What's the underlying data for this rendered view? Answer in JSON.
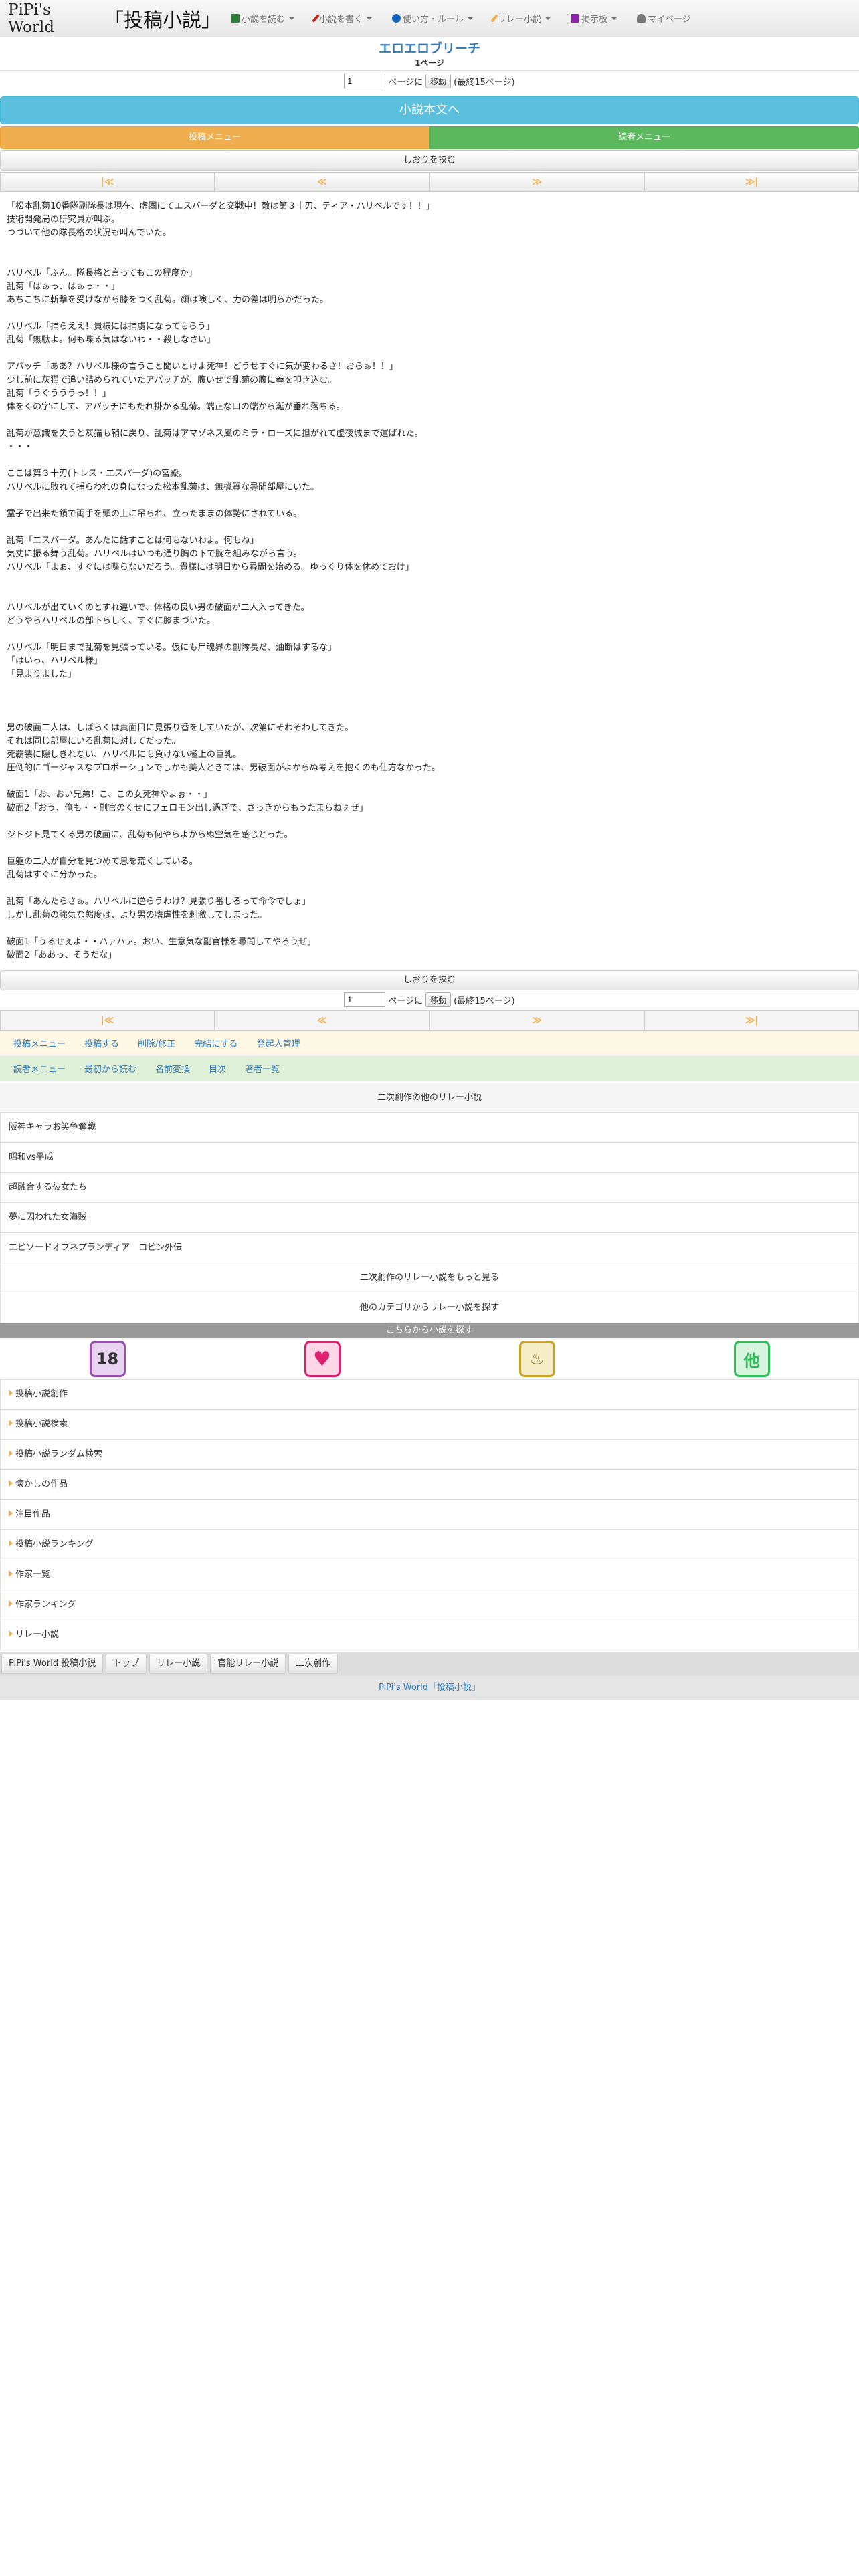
{
  "header": {
    "brand_en": "PiPi's World",
    "brand_jp": "「投稿小説」",
    "nav": [
      {
        "label": "小説を読む",
        "icon": "book-icon",
        "color": "#2e7d32"
      },
      {
        "label": "小説を書く",
        "icon": "pencil-icon",
        "color": "#c62828"
      },
      {
        "label": "使い方・ルール",
        "icon": "info-icon",
        "color": "#1565c0"
      },
      {
        "label": "リレー小説",
        "icon": "pencil-gold-icon",
        "color": "#f0ad4e"
      },
      {
        "label": "掲示板",
        "icon": "comment-icon",
        "color": "#8e24aa"
      },
      {
        "label": "マイページ",
        "icon": "user-icon",
        "color": "#777777"
      }
    ]
  },
  "title": {
    "novel_title": "エロエロブリーチ",
    "page_indicator": "1ページ"
  },
  "jump": {
    "value": "1",
    "label": "ページに",
    "button": "移動",
    "last_page": "(最終15ページ)"
  },
  "main_button": "小説本文へ",
  "menus": {
    "post_menu": "投稿メニュー",
    "reader_menu": "読者メニュー"
  },
  "bookmark": "しおりを挟む",
  "pager": {
    "first": "|≪",
    "prev": "≪",
    "next": "≫",
    "last": "≫|"
  },
  "story": [
    "「松本乱菊10番隊副隊長は現在、虚圏にてエスパーダと交戦中！敵は第３十刃、ティア・ハリベルです！！」",
    "技術開発局の研究員が叫ぶ。",
    "つづいて他の隊長格の状況も叫んでいた。",
    "",
    "",
    "ハリベル「ふん。隊長格と言ってもこの程度か」",
    "乱菊「はぁっ、はぁっ・・」",
    "あちこちに斬撃を受けながら膝をつく乱菊。顔は険しく、力の差は明らかだった。",
    "",
    "ハリベル「捕らええ！貴様には捕虜になってもらう」",
    "乱菊「無駄よ。何も喋る気はないわ・・殺しなさい」",
    "",
    "アパッチ「ああ？ハリベル様の言うこと聞いとけよ死神！どうせすぐに気が変わるさ！おらぁ！！」",
    "少し前に灰猫で追い詰められていたアパッチが、腹いせで乱菊の腹に拳を叩き込む。",
    "乱菊「うぐうううっ！！」",
    "体をくの字にして、アパッチにもたれ掛かる乱菊。端正な口の端から涎が垂れ落ちる。",
    "",
    "乱菊が意識を失うと灰猫も鞘に戻り、乱菊はアマゾネス風のミラ・ローズに担がれて虚夜城まで運ばれた。",
    "・・・",
    "",
    "ここは第３十刃(トレス・エスパーダ)の宮殿。",
    "ハリベルに敗れて捕らわれの身になった松本乱菊は、無機質な尋問部屋にいた。",
    "",
    "霊子で出来た鎖で両手を頭の上に吊られ、立ったままの体勢にされている。",
    "",
    "乱菊「エスパーダ。あんたに話すことは何もないわよ。何もね」",
    "気丈に振る舞う乱菊。ハリベルはいつも通り胸の下で腕を組みながら言う。",
    "ハリベル「まぁ、すぐには喋らないだろう。貴様には明日から尋問を始める。ゆっくり体を休めておけ」",
    "",
    "",
    "ハリベルが出ていくのとすれ違いで、体格の良い男の破面が二人入ってきた。",
    "どうやらハリベルの部下らしく、すぐに膝まづいた。",
    "",
    "ハリベル「明日まで乱菊を見張っている。仮にも尸魂界の副隊長だ、油断はするな」",
    "「はいっ、ハリベル様」",
    "「見まりました」",
    "",
    "",
    "",
    "男の破面二人は、しばらくは真面目に見張り番をしていたが、次第にそわそわしてきた。",
    "それは同じ部屋にいる乱菊に対してだった。",
    "死覇装に隠しきれない、ハリベルにも負けない極上の巨乳。",
    "圧倒的にゴージャスなプロポーションでしかも美人ときては、男破面がよからぬ考えを抱くのも仕方なかった。",
    "",
    "破面1「お、おい兄弟！こ、この女死神やよぉ・・」",
    "破面2「おう、俺も・・副官のくせにフェロモン出し過ぎで、さっきからもうたまらねぇぜ」",
    "",
    "ジトジト見てくる男の破面に、乱菊も何やらよからぬ空気を感じとった。",
    "",
    "巨躯の二人が自分を見つめて息を荒くしている。",
    "乱菊はすぐに分かった。",
    "",
    "乱菊「あんたらさぁ。ハリベルに逆らうわけ？見張り番しろって命令でしょ」",
    "しかし乱菊の強気な態度は、より男の嗜虐性を刺激してしまった。",
    "",
    "破面1「うるせぇよ・・ハァハァ。おい、生意気な副官様を尋問してやろうぜ」",
    "破面2「ああっ、そうだな」"
  ],
  "post_actions": [
    "投稿メニュー",
    "投稿する",
    "削除/修正",
    "完結にする",
    "発起人管理"
  ],
  "reader_actions": [
    "読者メニュー",
    "最初から読む",
    "名前変換",
    "目次",
    "著者一覧"
  ],
  "relay": {
    "header": "二次創作の他のリレー小説",
    "items": [
      "阪神キャラお笑争奪戦",
      "昭和vs平成",
      "超融合する彼女たち",
      "夢に囚われた女海賊",
      "エピソードオブネプランディア　ロビン外伝"
    ],
    "more": "二次創作のリレー小説をもっと見る",
    "other": "他のカテゴリからリレー小説を探す"
  },
  "search": {
    "header": "こちらから小説を探す",
    "categories": [
      {
        "label": "18",
        "icon": "adult-18-icon",
        "color": "#9b4fb5",
        "bg": "#e9d3f0"
      },
      {
        "label": "♥",
        "icon": "heart-icon",
        "color": "#e02070",
        "bg": "#ffd6e6"
      },
      {
        "label": "♨",
        "icon": "animal-icon",
        "color": "#c9a227",
        "bg": "#f5ecc8"
      },
      {
        "label": "他",
        "icon": "other-icon",
        "color": "#2ebd57",
        "bg": "#d6f5df"
      }
    ]
  },
  "links": [
    "投稿小説創作",
    "投稿小説検索",
    "投稿小説ランダム検索",
    "懐かしの作品",
    "注目作品",
    "投稿小説ランキング",
    "作家一覧",
    "作家ランキング",
    "リレー小説"
  ],
  "breadcrumb": [
    "PiPi's World 投稿小説",
    "トップ",
    "リレー小説",
    "官能リレー小説",
    "二次創作"
  ],
  "footer": "PiPi's World「投稿小説」"
}
